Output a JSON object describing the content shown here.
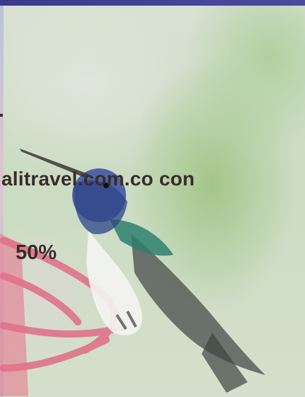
{
  "ad_text": {
    "dot": ".",
    "line1": "alitravel.com.co  con",
    "discount": "50%"
  },
  "colors": {
    "text": "#3a2b2b",
    "top_strip": "#3b3a8c",
    "background": "#cfdcc5"
  }
}
